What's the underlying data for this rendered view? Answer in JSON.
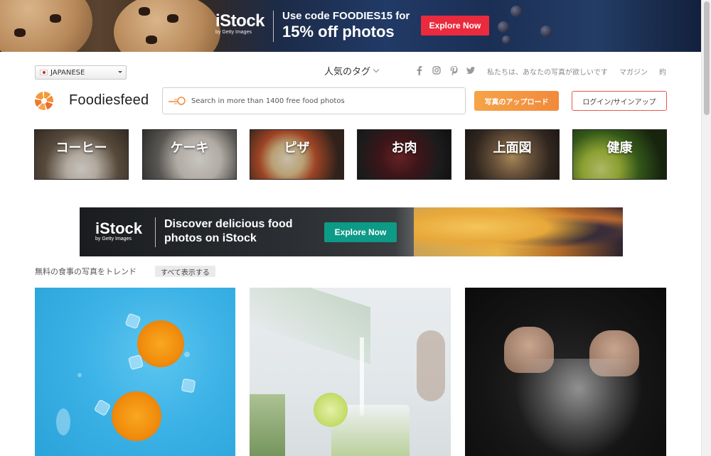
{
  "top_banner": {
    "brand": "iStock",
    "brand_sub": "by Getty Images",
    "line1": "Use code FOODIES15 for",
    "line2": "15% off photos",
    "cta": "Explore Now",
    "cta_color": "#ea2a3d"
  },
  "header": {
    "language": "JAPANESE",
    "tags_menu": "人気のタグ",
    "social": [
      "facebook-icon",
      "instagram-icon",
      "pinterest-icon",
      "twitter-icon"
    ],
    "links": [
      "私たちは、あなたの写真が欲しいです",
      "マガジン",
      "約"
    ]
  },
  "brand": {
    "name": "Foodiesfeed",
    "accent": "#f39a37"
  },
  "search": {
    "placeholder": "Search in more than 1400 free food photos"
  },
  "actions": {
    "upload": "写真のアップロード",
    "login": "ログイン/サインアップ"
  },
  "categories": [
    {
      "label": "コーヒー"
    },
    {
      "label": "ケーキ"
    },
    {
      "label": "ピザ"
    },
    {
      "label": "お肉"
    },
    {
      "label": "上面図"
    },
    {
      "label": "健康"
    }
  ],
  "mid_banner": {
    "brand": "iStock",
    "brand_sub": "by Getty Images",
    "line1": "Discover delicious food",
    "line2": "photos on iStock",
    "cta": "Explore Now",
    "cta_color": "#0d9a86"
  },
  "trending": {
    "title": "無料の食事の写真をトレンド",
    "show_all": "すべて表示する"
  }
}
